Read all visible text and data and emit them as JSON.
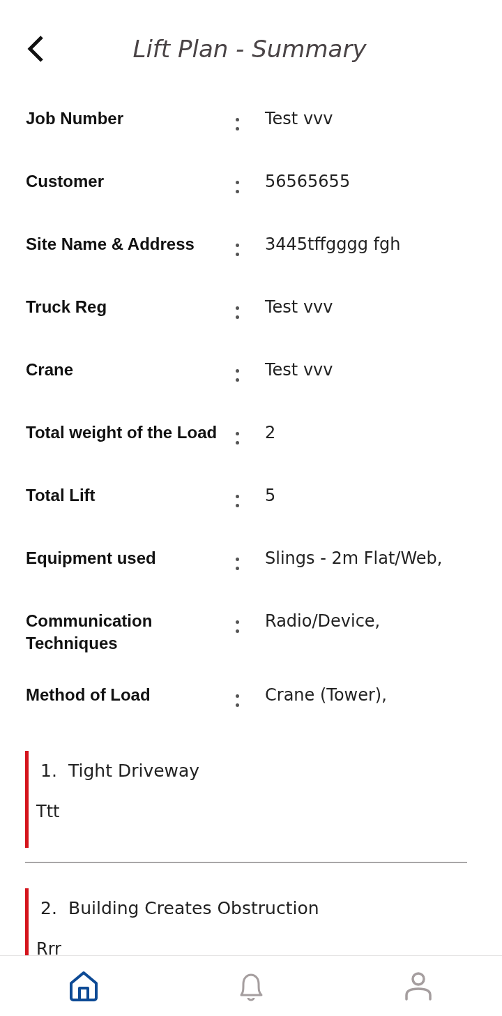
{
  "header": {
    "title": "Lift Plan - Summary"
  },
  "details": [
    {
      "label": "Job Number",
      "value": "Test vvv"
    },
    {
      "label": "Customer",
      "value": "56565655"
    },
    {
      "label": "Site Name & Address",
      "value": "3445tffgggg fgh"
    },
    {
      "label": "Truck Reg",
      "value": "Test vvv"
    },
    {
      "label": "Crane",
      "value": "Test vvv"
    },
    {
      "label": "Total weight of the Load",
      "value": "2"
    },
    {
      "label": "Total Lift",
      "value": "5"
    },
    {
      "label": "Equipment used",
      "value": "Slings - 2m Flat/Web,"
    },
    {
      "label": "Communication Techniques",
      "value": "Radio/Device,"
    },
    {
      "label": "Method of Load",
      "value": "Crane (Tower),"
    }
  ],
  "hazards": [
    {
      "number": "1.",
      "title": "Tight Driveway",
      "note": "Ttt"
    },
    {
      "number": "2.",
      "title": "Building Creates Obstruction",
      "note": "Rrr"
    }
  ],
  "bottom_nav": [
    {
      "kind": "home",
      "selected": true
    },
    {
      "kind": "bell",
      "selected": false
    },
    {
      "kind": "person",
      "selected": false
    }
  ]
}
